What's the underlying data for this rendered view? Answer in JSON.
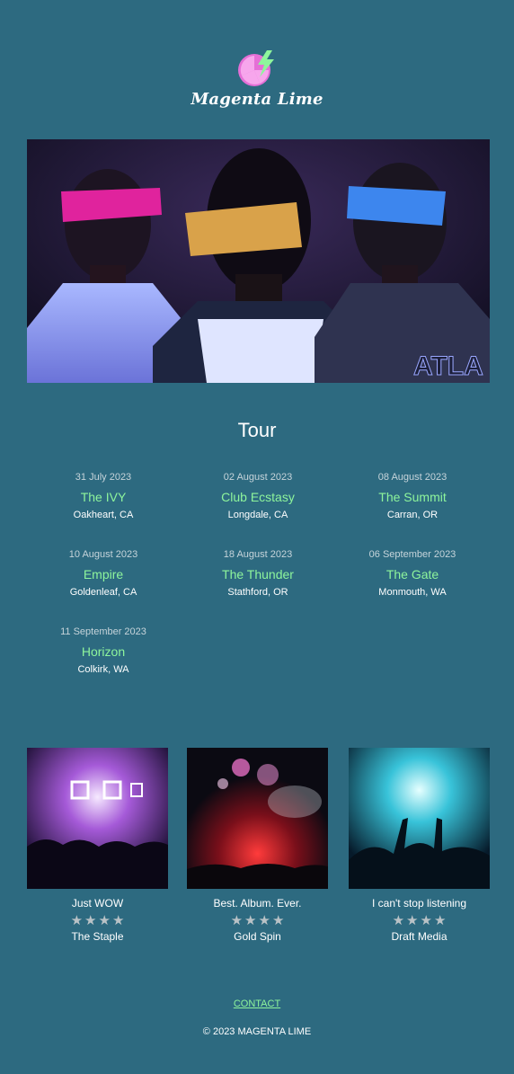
{
  "header": {
    "brand": "Magenta Lime",
    "logo_icon": "lime-slice-lightning-icon",
    "logo_colors": {
      "slice": "#e56fd6",
      "bolt": "#8ef59c"
    }
  },
  "hero": {
    "image": "three-blindfolded-people-photo"
  },
  "tour": {
    "title": "Tour",
    "events": [
      {
        "date": "31 July 2023",
        "venue": "The IVY",
        "city": "Oakheart, CA"
      },
      {
        "date": "02 August 2023",
        "venue": "Club Ecstasy",
        "city": "Longdale, CA"
      },
      {
        "date": "08 August 2023",
        "venue": "The Summit",
        "city": "Carran, OR"
      },
      {
        "date": "10 August 2023",
        "venue": "Empire",
        "city": "Goldenleaf, CA"
      },
      {
        "date": "18 August 2023",
        "venue": "The Thunder",
        "city": "Stathford, OR"
      },
      {
        "date": "06 September 2023",
        "venue": "The Gate",
        "city": "Monmouth, WA"
      },
      {
        "date": "11 September 2023",
        "venue": "Horizon",
        "city": "Colkirk, WA"
      }
    ]
  },
  "reviews": [
    {
      "quote": "Just WOW",
      "stars": 4,
      "source": "The Staple",
      "image": "concert-crowd-purple-photo"
    },
    {
      "quote": "Best. Album. Ever.",
      "stars": 4,
      "source": "Gold Spin",
      "image": "concert-fireworks-red-photo"
    },
    {
      "quote": "I can't stop listening",
      "stars": 4,
      "source": "Draft Media",
      "image": "concert-crowd-cyan-photo"
    }
  ],
  "footer": {
    "contact": "CONTACT",
    "copyright": "© 2023 MAGENTA LIME"
  },
  "colors": {
    "background": "#2d6a80",
    "accent": "#8ef59c",
    "date_text": "#c6d4da"
  }
}
